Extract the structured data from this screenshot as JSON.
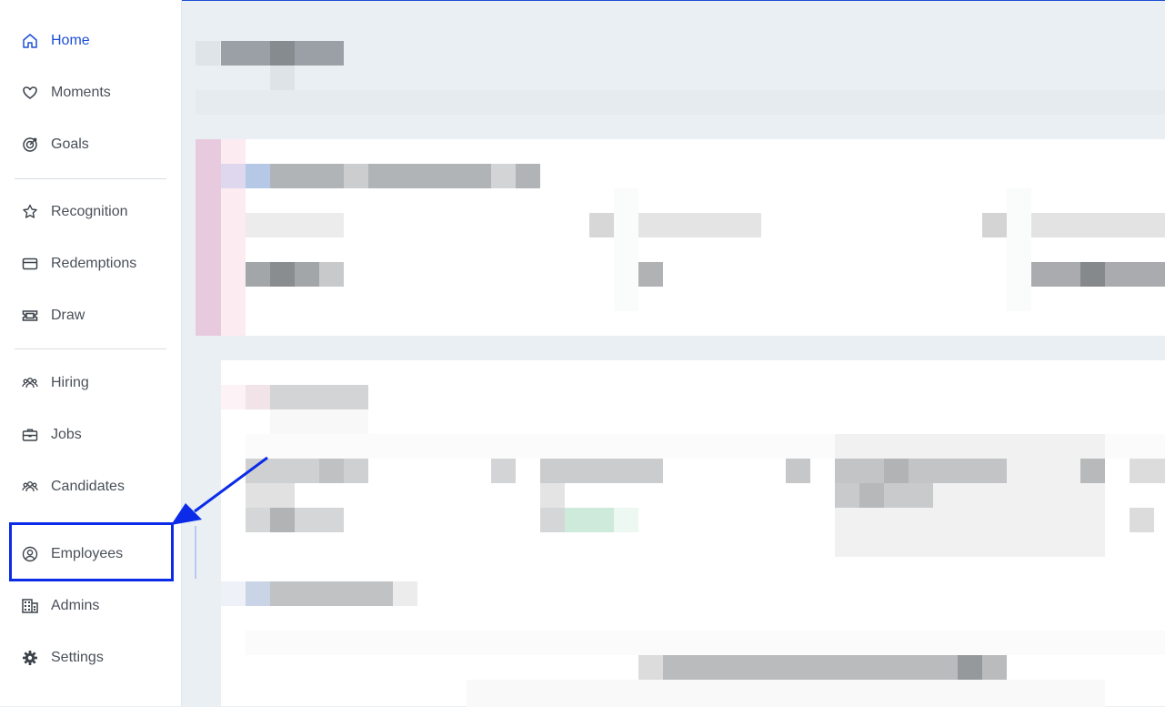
{
  "sidebar": {
    "items": [
      {
        "label": "Home",
        "icon": "home-icon",
        "active": true
      },
      {
        "label": "Moments",
        "icon": "heart-icon"
      },
      {
        "label": "Goals",
        "icon": "target-icon"
      },
      {
        "label": "Recognition",
        "icon": "star-badge-icon"
      },
      {
        "label": "Redemptions",
        "icon": "credit-card-icon"
      },
      {
        "label": "Draw",
        "icon": "ticket-icon"
      },
      {
        "label": "Hiring",
        "icon": "users-icon"
      },
      {
        "label": "Jobs",
        "icon": "briefcase-icon"
      },
      {
        "label": "Candidates",
        "icon": "users-icon"
      },
      {
        "label": "Employees",
        "icon": "user-circle-icon",
        "highlighted": true
      },
      {
        "label": "Admins",
        "icon": "building-icon"
      },
      {
        "label": "Settings",
        "icon": "gear-icon"
      }
    ]
  },
  "colors": {
    "accent": "#1d4ed8",
    "annotation": "#0b2be8",
    "text": "#4a5059",
    "main_background": "#e9eff3"
  },
  "annotation": {
    "type": "arrow-and-box",
    "target": "Employees"
  }
}
